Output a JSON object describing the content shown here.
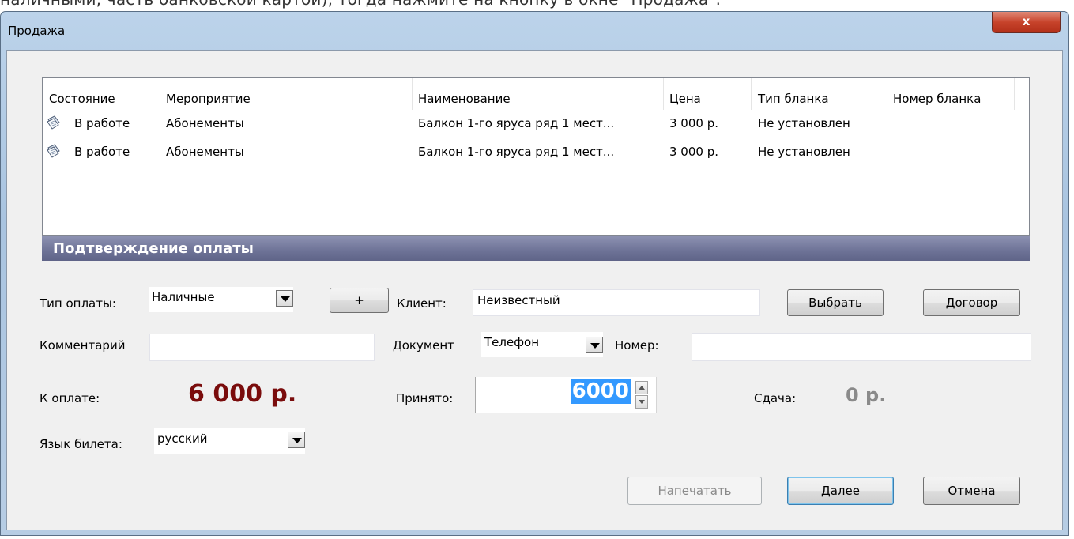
{
  "background_caption": "наличными, часть банковской картой), тогда нажмите на кнопку        в окне \"Продажа\".",
  "window": {
    "title": "Продажа",
    "close_label": "x"
  },
  "table": {
    "columns": [
      "Состояние",
      "Мероприятие",
      "Наименование",
      "Цена",
      "Тип бланка",
      "Номер бланка"
    ],
    "rows": [
      {
        "state": "В работе",
        "event": "Абонементы",
        "name": "Балкон 1-го яруса ряд 1 мест...",
        "price": "3 000 р.",
        "form_type": "Не установлен",
        "form_number": ""
      },
      {
        "state": "В работе",
        "event": "Абонементы",
        "name": "Балкон 1-го яруса ряд 1 мест...",
        "price": "3 000 р.",
        "form_type": "Не установлен",
        "form_number": ""
      }
    ]
  },
  "confirm": {
    "header": "Подтверждение оплаты",
    "payment_type_label": "Тип оплаты:",
    "payment_type_value": "Наличные",
    "add_button": "+",
    "client_label": "Клиент:",
    "client_value": "Неизвестный",
    "choose_button": "Выбрать",
    "contract_button": "Договор",
    "comment_label": "Комментарий",
    "comment_value": "",
    "document_label": "Документ",
    "document_value": "Телефон",
    "number_label": "Номер:",
    "number_value": "",
    "to_pay_label": "К оплате:",
    "to_pay_value": "6 000 р.",
    "accepted_label": "Принято:",
    "accepted_value": "6000",
    "change_label": "Сдача:",
    "change_value": "0 р.",
    "ticket_lang_label": "Язык билета:",
    "ticket_lang_value": "русский"
  },
  "buttons": {
    "print": "Напечатать",
    "next": "Далее",
    "cancel": "Отмена"
  },
  "colors": {
    "amount": "#7a0c0c",
    "header_bar": "#6e7397",
    "selection": "#3399ff"
  }
}
